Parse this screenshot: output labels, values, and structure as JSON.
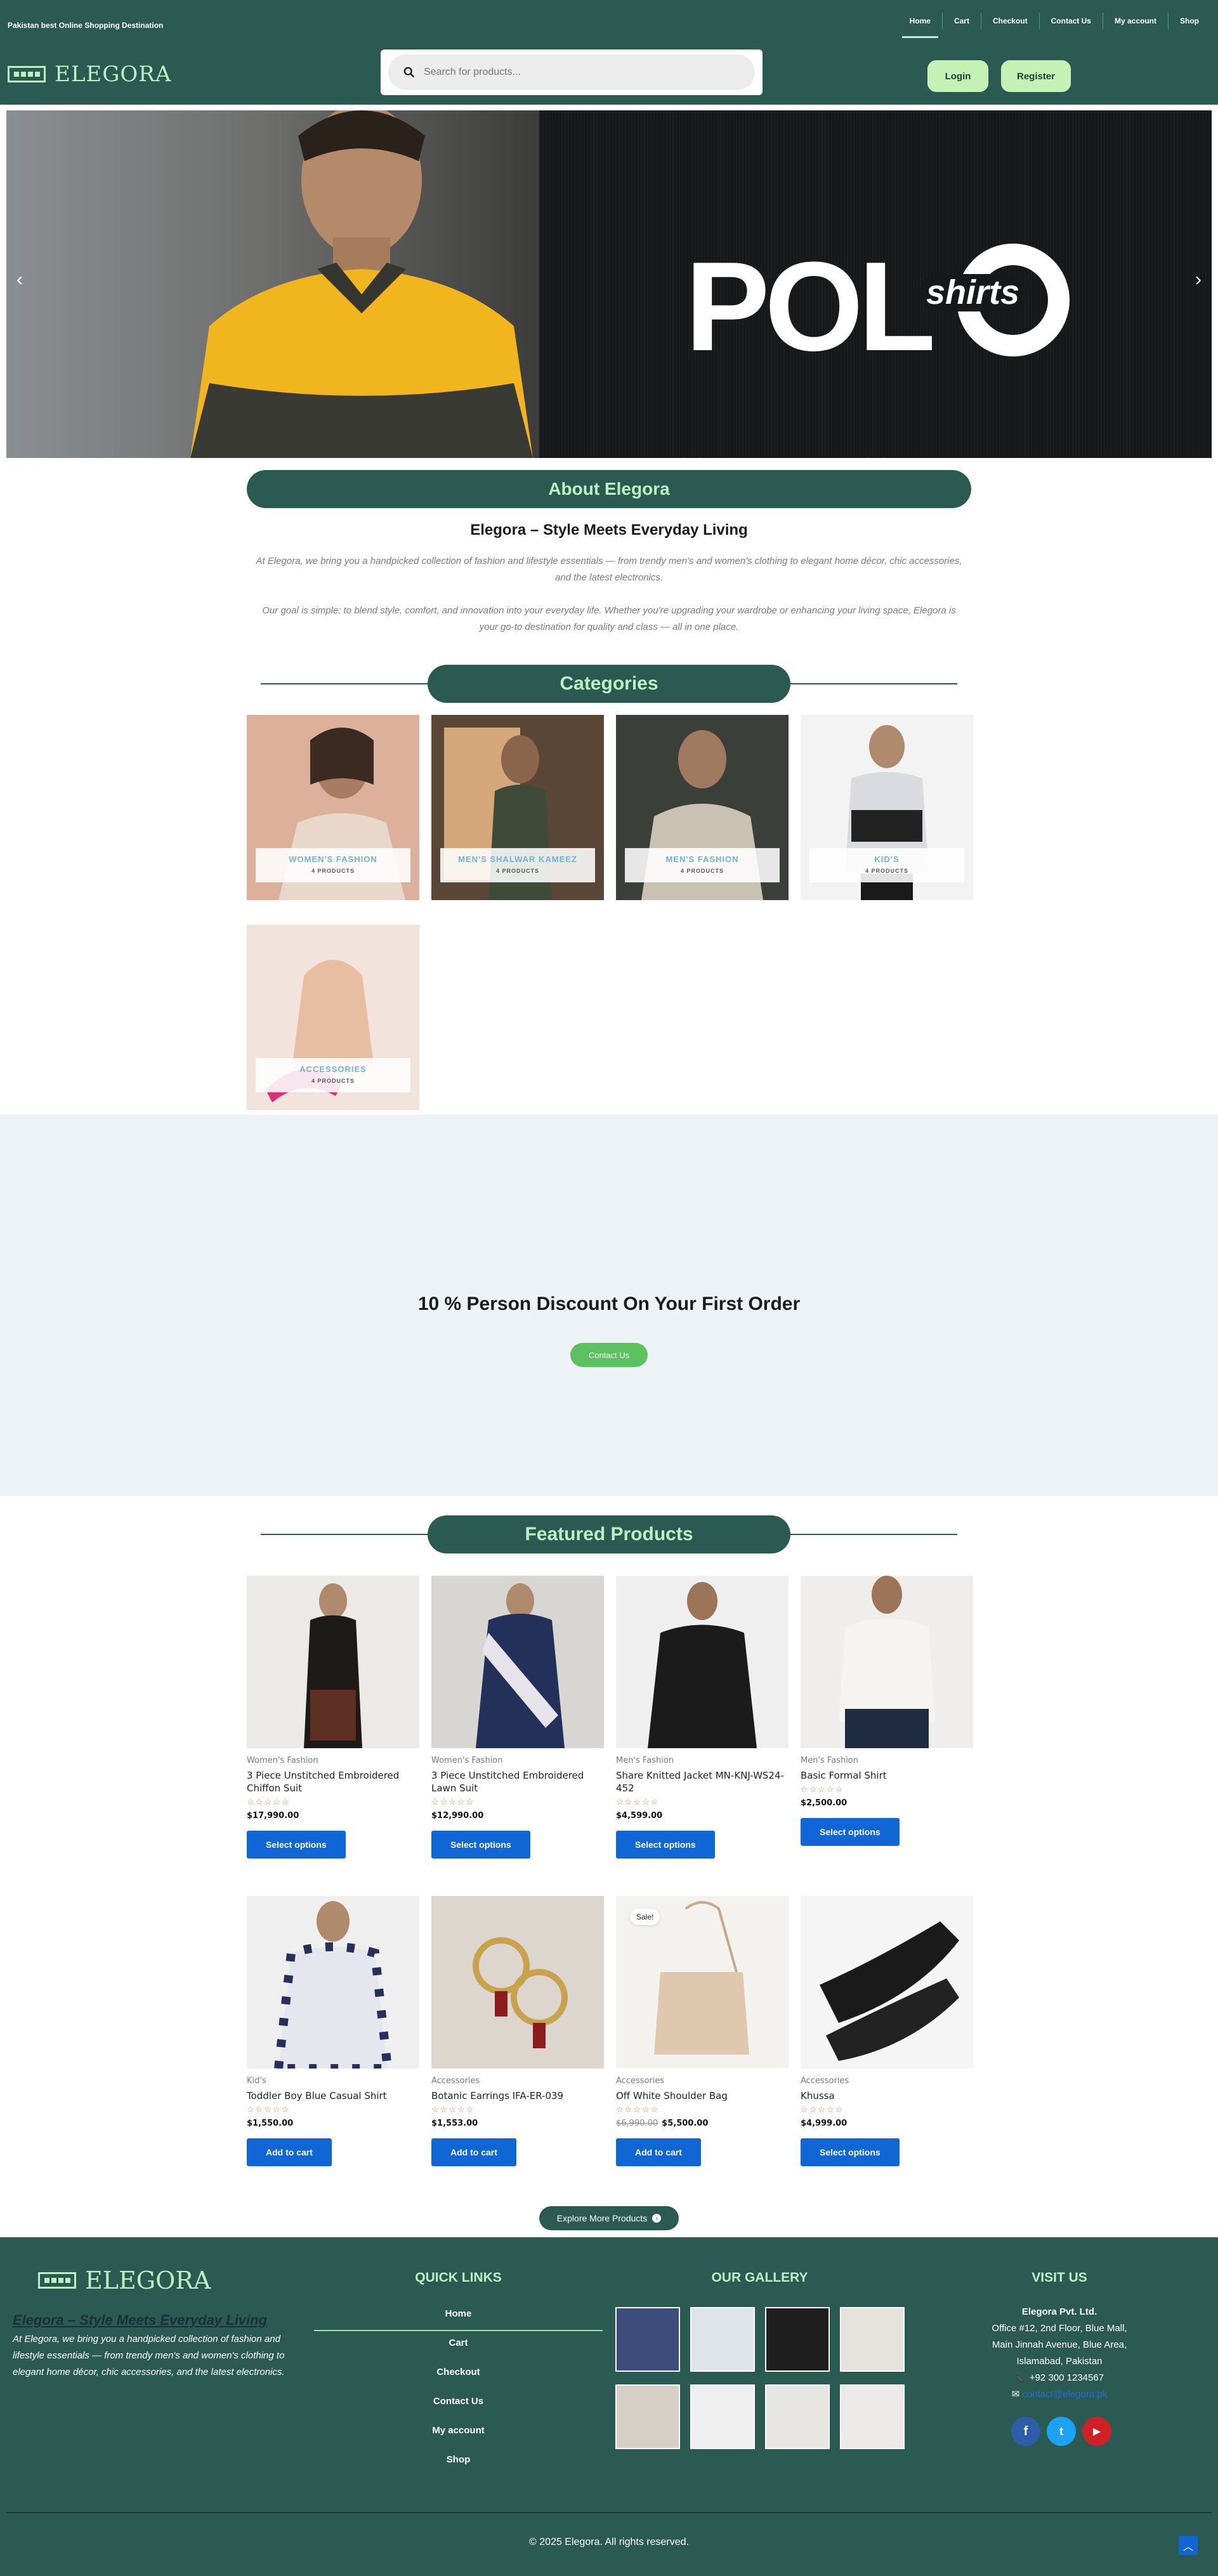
{
  "header": {
    "tagline": "Pakistan best Online Shopping Destination",
    "nav": [
      "Home",
      "Cart",
      "Checkout",
      "Contact Us",
      "My account",
      "Shop"
    ],
    "brand": "ELEGORA",
    "search_placeholder": "Search for products...",
    "login": "Login",
    "register": "Register"
  },
  "hero": {
    "word_big": "POL",
    "word_small": "shirts",
    "prev_icon": "chevron-left-icon",
    "next_icon": "chevron-right-icon"
  },
  "about": {
    "title": "About Elegora",
    "subtitle": "Elegora – Style Meets Everyday Living",
    "p1": "At Elegora, we bring you a handpicked collection of fashion and lifestyle essentials — from trendy men's and women's clothing to elegant home décor, chic accessories, and the latest electronics.",
    "p2": "Our goal is simple: to blend style, comfort, and innovation into your everyday life. Whether you're upgrading your wardrobe or enhancing your living space, Elegora is your go-to destination for quality and class — all in one place."
  },
  "categories": {
    "title": "Categories",
    "items": [
      {
        "name": "WOMEN'S FASHION",
        "count": "4 PRODUCTS"
      },
      {
        "name": "MEN'S SHALWAR KAMEEZ",
        "count": "4 PRODUCTS"
      },
      {
        "name": "MEN'S FASHION",
        "count": "4 PRODUCTS"
      },
      {
        "name": "KID'S",
        "count": "4 PRODUCTS"
      },
      {
        "name": "ACCESSORIES",
        "count": "4 PRODUCTS"
      }
    ]
  },
  "promo": {
    "title": "10 % Person Discount On Your First Order",
    "button": "Contact Us"
  },
  "featured": {
    "title": "Featured Products",
    "stars": "☆☆☆☆☆",
    "products": [
      {
        "category": "Women's Fashion",
        "name": "3 Piece Unstitched Embroidered Chiffon Suit",
        "price": "$17,990.00",
        "old_price": "",
        "button": "Select options",
        "sale": ""
      },
      {
        "category": "Women's Fashion",
        "name": "3 Piece Unstitched Embroidered Lawn Suit",
        "price": "$12,990.00",
        "old_price": "",
        "button": "Select options",
        "sale": ""
      },
      {
        "category": "Men's Fashion",
        "name": "Share Knitted Jacket MN-KNJ-WS24-452",
        "price": "$4,599.00",
        "old_price": "",
        "button": "Select options",
        "sale": ""
      },
      {
        "category": "Men's Fashion",
        "name": "Basic Formal Shirt",
        "price": "$2,500.00",
        "old_price": "",
        "button": "Select options",
        "sale": ""
      },
      {
        "category": "Kid's",
        "name": "Toddler Boy Blue Casual Shirt",
        "price": "$1,550.00",
        "old_price": "",
        "button": "Add to cart",
        "sale": ""
      },
      {
        "category": "Accessories",
        "name": "Botanic Earrings IFA-ER-039",
        "price": "$1,553.00",
        "old_price": "",
        "button": "Add to cart",
        "sale": ""
      },
      {
        "category": "Accessories",
        "name": "Off White Shoulder Bag",
        "price": "$5,500.00",
        "old_price": "$6,990.00",
        "button": "Add to cart",
        "sale": "Sale!"
      },
      {
        "category": "Accessories",
        "name": "Khussa",
        "price": "$4,999.00",
        "old_price": "",
        "button": "Select options",
        "sale": ""
      }
    ],
    "explore": "Explore More Products"
  },
  "footer": {
    "brand": "ELEGORA",
    "tagline": "Elegora – Style Meets Everyday Living",
    "desc": "At Elegora, we bring you a handpicked collection of fashion and lifestyle essentials — from trendy men's and women's clothing to elegant home décor, chic accessories, and the latest electronics.",
    "quick_links_title": "QUICK LINKS",
    "quick_links": [
      "Home",
      "Cart",
      "Checkout",
      "Contact Us",
      "My account",
      "Shop"
    ],
    "gallery_title": "OUR GALLERY",
    "visit_title": "VISIT US",
    "company": "Elegora Pvt. Ltd.",
    "address1": "Office #12, 2nd Floor, Blue Mall,",
    "address2": "Main Jinnah Avenue, Blue Area,",
    "address3": "Islamabad, Pakistan",
    "phone": "+92 300 1234567",
    "email": "contact@elegora.pk",
    "social": [
      "facebook-icon",
      "twitter-icon",
      "youtube-icon"
    ],
    "copyright": "© 2025 Elegora. All rights reserved."
  },
  "colors": {
    "primary": "#2b5a52",
    "accent": "#bff0bf",
    "button": "#1166d6",
    "promo_bg": "#edf2f7"
  }
}
